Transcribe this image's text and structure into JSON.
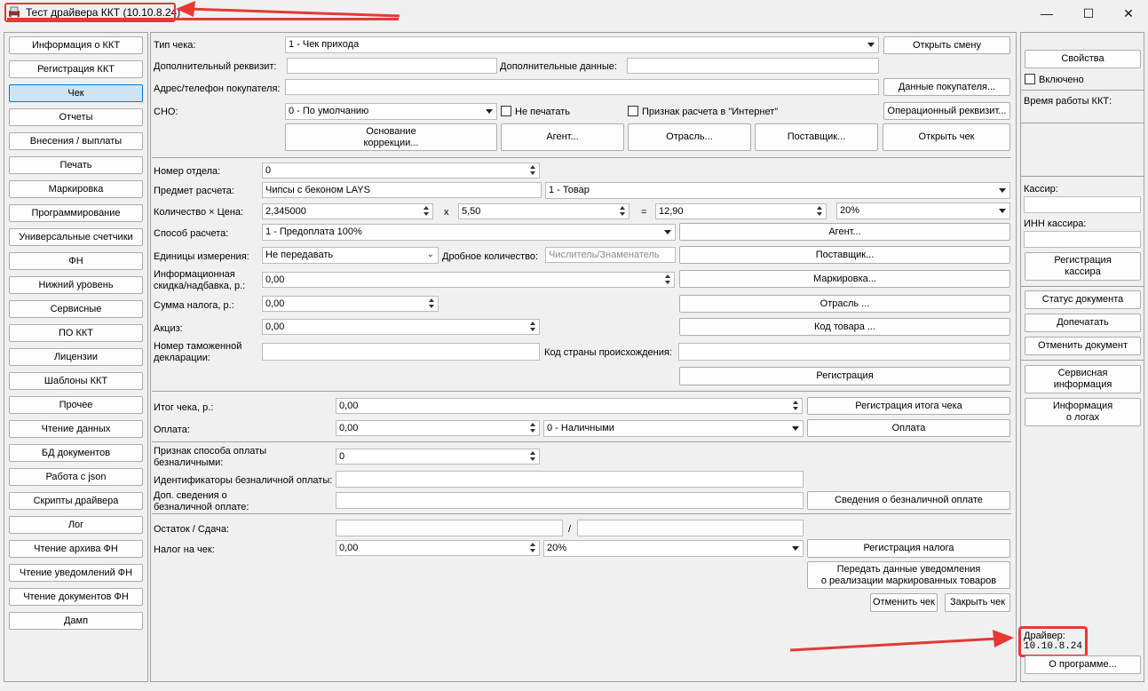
{
  "window": {
    "title": "Тест драйвера ККТ (10.10.8.24)",
    "min": "—",
    "max": "☐",
    "close": "✕"
  },
  "sidebar": {
    "items": [
      {
        "label": "Информация о ККТ"
      },
      {
        "label": "Регистрация ККТ"
      },
      {
        "label": "Чек",
        "selected": true
      },
      {
        "label": "Отчеты"
      },
      {
        "label": "Внесения / выплаты"
      },
      {
        "label": "Печать"
      },
      {
        "label": "Маркировка"
      },
      {
        "label": "Программирование"
      },
      {
        "label": "Универсальные счетчики"
      },
      {
        "label": "ФН"
      },
      {
        "label": "Нижний уровень"
      },
      {
        "label": "Сервисные"
      },
      {
        "label": "ПО ККТ"
      },
      {
        "label": "Лицензии"
      },
      {
        "label": "Шаблоны ККТ"
      },
      {
        "label": "Прочее"
      },
      {
        "label": "Чтение данных"
      },
      {
        "label": "БД документов"
      },
      {
        "label": "Работа с json"
      },
      {
        "label": "Скрипты драйвера"
      },
      {
        "label": "Лог"
      },
      {
        "label": "Чтение архива ФН"
      },
      {
        "label": "Чтение уведомлений ФН"
      },
      {
        "label": "Чтение документов ФН"
      },
      {
        "label": "Дамп"
      }
    ]
  },
  "receipt": {
    "type_label": "Тип чека:",
    "type_value": "1 - Чек прихода",
    "open_shift": "Открыть смену",
    "extra_req_label": "Дополнительный реквизит:",
    "extra_data_label": "Дополнительные данные:",
    "buyer_addr_label": "Адрес/телефон покупателя:",
    "buyer_data": "Данные покупателя...",
    "sno_label": "СНО:",
    "sno_value": "0 - По умолчанию",
    "no_print": "Не печатать",
    "internet": "Признак расчета в \"Интернет\"",
    "op_req": "Операционный реквизит...",
    "correction": "Основание\nкоррекции...",
    "agent": "Агент...",
    "industry": "Отрасль...",
    "supplier": "Поставщик...",
    "open_receipt": "Открыть чек"
  },
  "item": {
    "dept_label": "Номер отдела:",
    "dept_value": "0",
    "subject_label": "Предмет расчета:",
    "subject_value": "Чипсы с беконом LAYS",
    "subject_type": "1 - Товар",
    "qty_price_label": "Количество × Цена:",
    "qty": "2,345000",
    "x": "x",
    "price": "5,50",
    "eq": "=",
    "sum": "12,90",
    "vat": "20%",
    "method_label": "Способ расчета:",
    "method_value": "1 - Предоплата 100%",
    "agent": "Агент...",
    "units_label": "Единицы измерения:",
    "units_value": "Не передавать",
    "fraction_label": "Дробное количество:",
    "fraction_ph": "Числитель/Знаменатель",
    "supplier": "Поставщик...",
    "discount_label": "Информационная\nскидка/надбавка, р.:",
    "discount_value": "0,00",
    "marking": "Маркировка...",
    "tax_label": "Сумма налога, р.:",
    "tax_value": "0,00",
    "industry": "Отрасль ...",
    "excise_label": "Акциз:",
    "excise_value": "0,00",
    "code": "Код товара ...",
    "customs_label": "Номер таможенной\nдекларации:",
    "country_label": "Код страны происхождения:",
    "register": "Регистрация"
  },
  "totals": {
    "total_label": "Итог чека, р.:",
    "total_value": "0,00",
    "reg_total": "Регистрация итога чека",
    "pay_label": "Оплата:",
    "pay_value": "0,00",
    "pay_type": "0 - Наличными",
    "pay_btn": "Оплата",
    "cashless_label": "Признак способа оплаты\nбезналичными:",
    "cashless_value": "0",
    "cashless_ids_label": "Идентификаторы безналичной оплаты:",
    "cashless_info_label": "Доп. сведения о\nбезналичной оплате:",
    "cashless_info_btn": "Сведения о безналичной оплате",
    "change_label": "Остаток / Сдача:",
    "slash": "/",
    "tax_label": "Налог на чек:",
    "tax_value": "0,00",
    "tax_rate": "20%",
    "reg_tax": "Регистрация налога",
    "notify": "Передать данные уведомления\nо реализации маркированных товаров",
    "cancel": "Отменить чек",
    "close": "Закрыть чек"
  },
  "right": {
    "props": "Свойства",
    "enabled": "Включено",
    "uptime_label": "Время работы ККТ:",
    "cashier_label": "Кассир:",
    "inn_label": "ИНН кассира:",
    "reg_cashier": "Регистрация\nкассира",
    "doc_status": "Статус документа",
    "reprint": "Допечатать",
    "cancel_doc": "Отменить документ",
    "service_info": "Сервисная\nинформация",
    "log_info": "Информация\nо логах",
    "driver_label": "Драйвер:",
    "driver_version": "10.10.8.24",
    "about": "О программе..."
  },
  "colors": {
    "accent": "#e53935",
    "selected": "#cde4f7"
  }
}
